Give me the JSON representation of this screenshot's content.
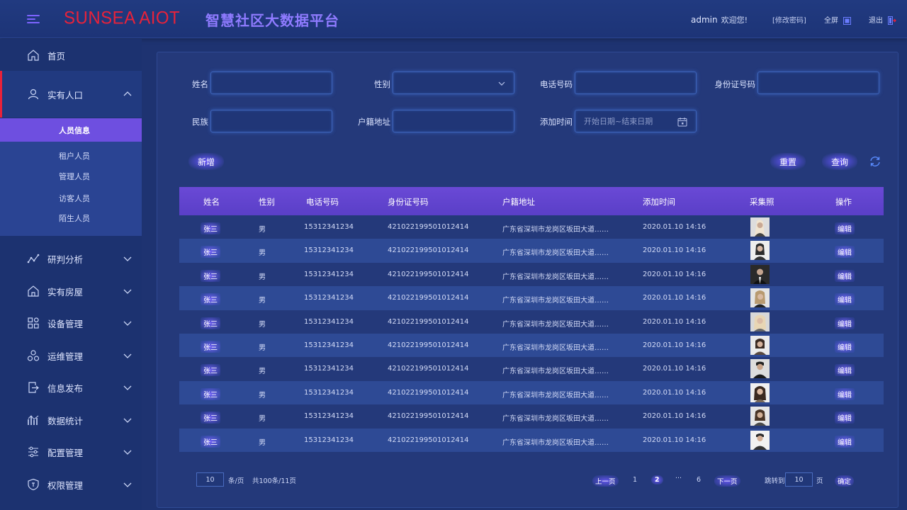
{
  "header": {
    "logo_text": "SUNSEA AIOT",
    "platform_title": "智慧社区大数据平台",
    "username": "admin",
    "welcome": "欢迎您!",
    "change_password": "[修改密码]",
    "fullscreen": "全屏",
    "logout": "退出"
  },
  "sidebar": {
    "home": "首页",
    "group_population": "实有人口",
    "sub_items": [
      "人员信息",
      "租户人员",
      "管理人员",
      "访客人员",
      "陌生人员"
    ],
    "groups": [
      "研判分析",
      "实有房屋",
      "设备管理",
      "运维管理",
      "信息发布",
      "数据统计",
      "配置管理",
      "权限管理"
    ]
  },
  "filters": {
    "name_label": "姓名",
    "gender_label": "性别",
    "phone_label": "电话号码",
    "idcard_label": "身份证号码",
    "ethnic_label": "民族",
    "address_label": "户籍地址",
    "added_time_label": "添加时间",
    "date_placeholder": "开始日期~结束日期"
  },
  "actions": {
    "add": "新增",
    "reset": "重置",
    "query": "查询"
  },
  "table": {
    "columns": [
      "姓名",
      "性别",
      "电话号码",
      "身份证号码",
      "户籍地址",
      "添加时间",
      "采集照",
      "操作"
    ],
    "rows": [
      {
        "name": "张三",
        "gender": "男",
        "phone": "15312341234",
        "id": "421022199501012414",
        "address": "广东省深圳市龙岗区坂田大道……",
        "time": "2020.01.10 14:16",
        "action": "编辑"
      },
      {
        "name": "张三",
        "gender": "男",
        "phone": "15312341234",
        "id": "421022199501012414",
        "address": "广东省深圳市龙岗区坂田大道……",
        "time": "2020.01.10 14:16",
        "action": "编辑"
      },
      {
        "name": "张三",
        "gender": "男",
        "phone": "15312341234",
        "id": "421022199501012414",
        "address": "广东省深圳市龙岗区坂田大道……",
        "time": "2020.01.10 14:16",
        "action": "编辑"
      },
      {
        "name": "张三",
        "gender": "男",
        "phone": "15312341234",
        "id": "421022199501012414",
        "address": "广东省深圳市龙岗区坂田大道……",
        "time": "2020.01.10 14:16",
        "action": "编辑"
      },
      {
        "name": "张三",
        "gender": "男",
        "phone": "15312341234",
        "id": "421022199501012414",
        "address": "广东省深圳市龙岗区坂田大道……",
        "time": "2020.01.10 14:16",
        "action": "编辑"
      },
      {
        "name": "张三",
        "gender": "男",
        "phone": "15312341234",
        "id": "421022199501012414",
        "address": "广东省深圳市龙岗区坂田大道……",
        "time": "2020.01.10 14:16",
        "action": "编辑"
      },
      {
        "name": "张三",
        "gender": "男",
        "phone": "15312341234",
        "id": "421022199501012414",
        "address": "广东省深圳市龙岗区坂田大道……",
        "time": "2020.01.10 14:16",
        "action": "编辑"
      },
      {
        "name": "张三",
        "gender": "男",
        "phone": "15312341234",
        "id": "421022199501012414",
        "address": "广东省深圳市龙岗区坂田大道……",
        "time": "2020.01.10 14:16",
        "action": "编辑"
      },
      {
        "name": "张三",
        "gender": "男",
        "phone": "15312341234",
        "id": "421022199501012414",
        "address": "广东省深圳市龙岗区坂田大道……",
        "time": "2020.01.10 14:16",
        "action": "编辑"
      },
      {
        "name": "张三",
        "gender": "男",
        "phone": "15312341234",
        "id": "421022199501012414",
        "address": "广东省深圳市龙岗区坂田大道……",
        "time": "2020.01.10 14:16",
        "action": "编辑"
      }
    ]
  },
  "pagination": {
    "page_size": "10",
    "per_page": "条/页",
    "total": "共100条/11页",
    "prev": "上一页",
    "pages": [
      "1",
      "2",
      "···",
      "6"
    ],
    "current": "2",
    "next": "下一页",
    "jump_to": "跳转到",
    "jump_value": "10",
    "page_unit": "页",
    "confirm": "确定"
  },
  "colors": {
    "brand_red": "#e8223a",
    "accent_purple": "#6e4fe0",
    "background": "#1e3371"
  }
}
